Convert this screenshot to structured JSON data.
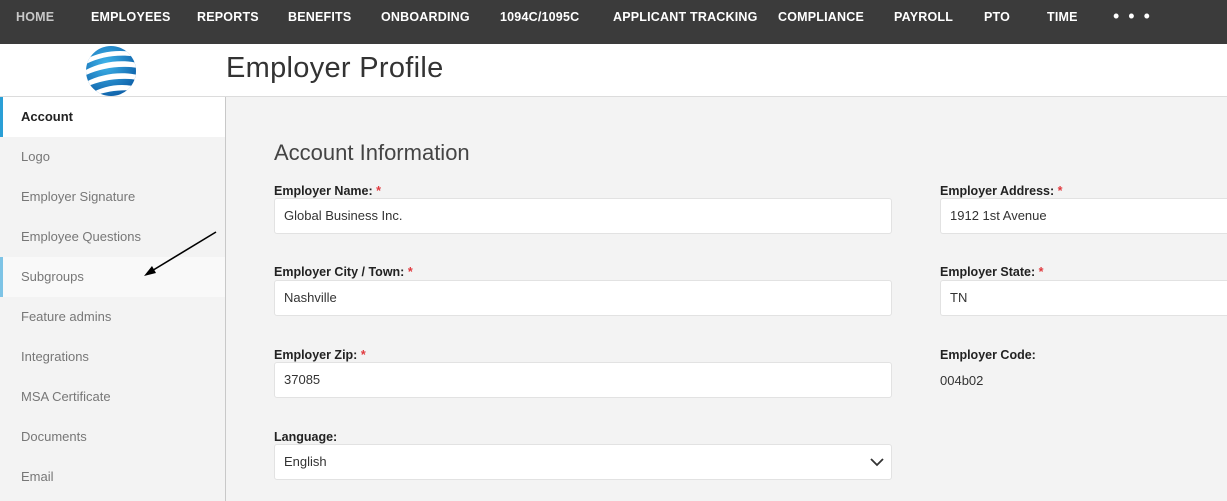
{
  "nav": {
    "items": [
      "HOME",
      "EMPLOYEES",
      "REPORTS",
      "BENEFITS",
      "ONBOARDING",
      "1094C/1095C",
      "APPLICANT TRACKING",
      "COMPLIANCE",
      "PAYROLL",
      "PTO",
      "TIME"
    ],
    "more": "• • •"
  },
  "header": {
    "title": "Employer Profile"
  },
  "sidebar": {
    "items": [
      "Account",
      "Logo",
      "Employer Signature",
      "Employee Questions",
      "Subgroups",
      "Feature admins",
      "Integrations",
      "MSA Certificate",
      "Documents",
      "Email"
    ],
    "active": "Account",
    "hovered": "Subgroups"
  },
  "main": {
    "section_title": "Account Information",
    "required_mark": "*",
    "fields": {
      "employer_name": {
        "label": "Employer Name:",
        "value": "Global Business Inc."
      },
      "employer_address": {
        "label": "Employer Address:",
        "value": "1912 1st Avenue"
      },
      "employer_city": {
        "label": "Employer City / Town:",
        "value": "Nashville"
      },
      "employer_state": {
        "label": "Employer State:",
        "value": "TN"
      },
      "employer_zip": {
        "label": "Employer Zip:",
        "value": "37085"
      },
      "employer_code": {
        "label": "Employer Code:",
        "value": "004b02"
      },
      "language": {
        "label": "Language:",
        "value": "English"
      }
    }
  },
  "colors": {
    "nav_bg": "#3b3b3b",
    "accent": "#2a9fd6",
    "required": "#e0393e"
  }
}
